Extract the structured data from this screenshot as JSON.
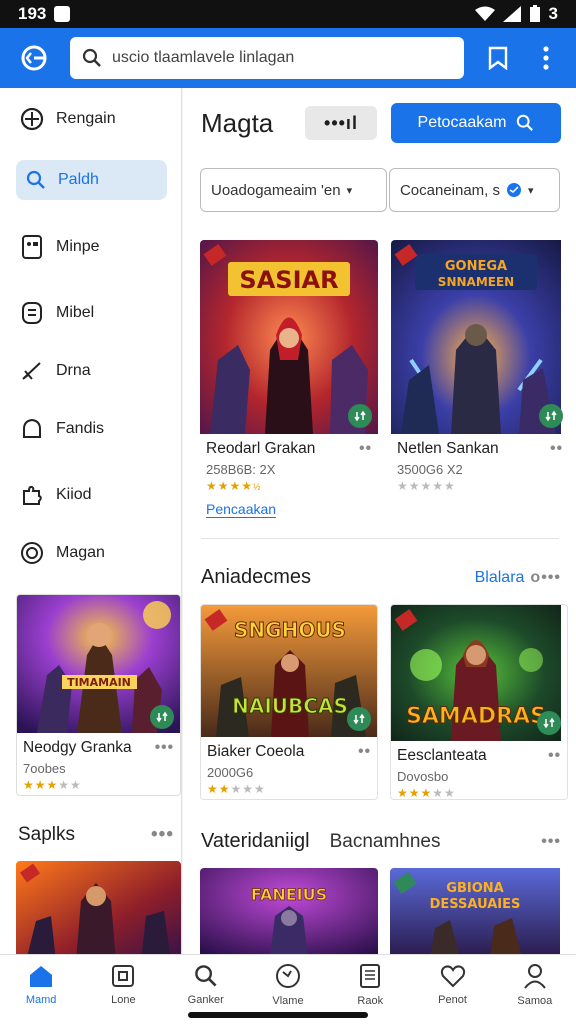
{
  "status": {
    "time": "193"
  },
  "appbar": {
    "search_text": "uscio tlaamlavele linlagan"
  },
  "sidebar": {
    "items": [
      {
        "label": "Rengain",
        "icon": "compass-icon"
      },
      {
        "label": "Paldh",
        "icon": "search-icon"
      },
      {
        "label": "Minpe",
        "icon": "controller-icon"
      },
      {
        "label": "Mibel",
        "icon": "gamepad-icon"
      },
      {
        "label": "Drna",
        "icon": "sword-icon"
      },
      {
        "label": "Fandis",
        "icon": "bell-icon"
      },
      {
        "label": "Kiiod",
        "icon": "puzzle-icon"
      },
      {
        "label": "Magan",
        "icon": "circle-icon"
      }
    ],
    "card": {
      "title": "Neodgy Granka",
      "sub": "7oobes",
      "rating": 3
    },
    "section_title": "Saplks"
  },
  "main": {
    "title": "Magta",
    "dots_label": "•••ıl",
    "primary_label": "Petocaakam",
    "filter1": "Uoadogameaim 'en",
    "filter2": "Cocaneinam, s",
    "top_cards": [
      {
        "title": "Reodarl Grakan",
        "sub": "258B6B: 2X",
        "rating": 4,
        "link": "Pencaakan"
      },
      {
        "title": "Netlen Sankan",
        "sub": "3500G6 X2",
        "rating": 0
      }
    ],
    "section2": {
      "title": "Aniadecmes",
      "link": "Blalara"
    },
    "mid_cards": [
      {
        "title": "Biaker Coeola",
        "sub": "2000G6",
        "rating": 2
      },
      {
        "title": "Eesclanteata",
        "sub": "Dovosbo",
        "rating": 3
      }
    ],
    "section3": {
      "title": "Vateridaniigl",
      "subtitle": "Bacnamhnes"
    }
  },
  "bottom_nav": [
    {
      "label": "Mamd",
      "icon": "home-icon",
      "active": true
    },
    {
      "label": "Lone",
      "icon": "square-icon"
    },
    {
      "label": "Ganker",
      "icon": "search-icon"
    },
    {
      "label": "Vlame",
      "icon": "globe-icon"
    },
    {
      "label": "Raok",
      "icon": "book-icon"
    },
    {
      "label": "Penot",
      "icon": "heart-icon"
    },
    {
      "label": "Samoa",
      "icon": "person-icon"
    }
  ],
  "colors": {
    "accent": "#1a73e8",
    "badge": "#2e8b57",
    "star": "#e6a100"
  }
}
